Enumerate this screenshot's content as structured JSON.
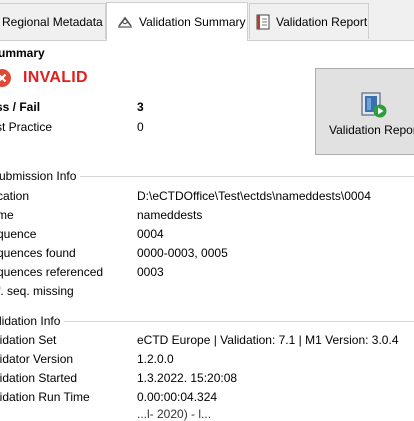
{
  "tabs": [
    {
      "label": "Regional Metadata"
    },
    {
      "label": "Validation Summary"
    },
    {
      "label": "Validation Report"
    }
  ],
  "summary": {
    "title": "ummary",
    "status": "INVALID",
    "rows": [
      {
        "label": "ss / Fail",
        "value": "3"
      },
      {
        "label": "st Practice",
        "value": "0"
      }
    ]
  },
  "validation_report_button": {
    "label": "Validation Repor"
  },
  "submission_info": {
    "title": "ubmission Info",
    "rows": [
      {
        "label": "cation",
        "value": "D:\\eCTDOffice\\Test\\ectds\\nameddests\\0004"
      },
      {
        "label": "me",
        "value": "nameddests"
      },
      {
        "label": "quence",
        "value": "0004"
      },
      {
        "label": "quences found",
        "value": "0000-0003, 0005"
      },
      {
        "label": "quences referenced",
        "value": "0003"
      },
      {
        "label": "f. seq. missing",
        "value": ""
      }
    ]
  },
  "validation_info": {
    "title": "lidation Info",
    "rows": [
      {
        "label": "lidation Set",
        "value": "eCTD Europe | Validation: 7.1 | M1 Version: 3.0.4"
      },
      {
        "label": "lidator Version",
        "value": "1.2.0.0"
      },
      {
        "label": "lidation Started",
        "value": "1.3.2022. 15:20:08"
      },
      {
        "label": "lidation Run Time",
        "value": "0.00:00:04.324"
      },
      {
        "label": "",
        "value": "...l- 2020) - l..."
      }
    ]
  },
  "colors": {
    "status_red": "#e01f1f",
    "accent": "#2e7d32"
  },
  "icons": {
    "tab_summary": "validation-summary-icon",
    "tab_report": "report-document-icon",
    "status": "error-circle-icon",
    "button": "run-report-icon"
  }
}
